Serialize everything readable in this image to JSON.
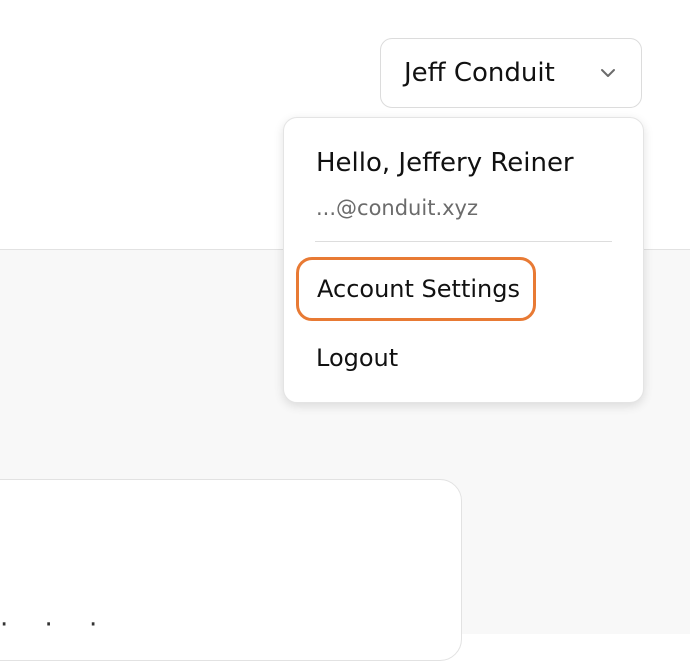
{
  "user_menu": {
    "trigger_name": "Jeff Conduit",
    "chevron_icon": "chevron-down-icon",
    "greeting": "Hello, Jeffery Reiner",
    "email": "...@conduit.xyz",
    "items": [
      {
        "label": "Account Settings",
        "highlighted": true
      },
      {
        "label": "Logout",
        "highlighted": false
      }
    ]
  },
  "card": {
    "fragment_text": "· · ·"
  },
  "colors": {
    "highlight_border": "#e87a34",
    "page_background": "#f8f8f8",
    "border": "#e2e2e2"
  }
}
